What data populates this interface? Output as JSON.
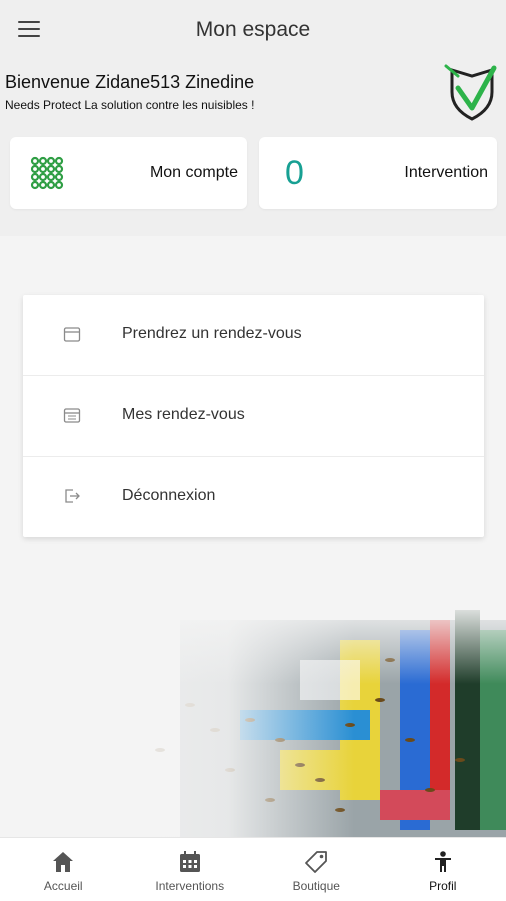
{
  "appbar": {
    "title": "Mon espace",
    "menu_icon": "hamburger-menu-icon"
  },
  "welcome": {
    "title": "Bienvenue Zidane513 Zinedine",
    "subtitle": "Needs Protect La solution contre les nuisibles !"
  },
  "logo": {
    "name": "shield-check-logo",
    "color": "#2db34a"
  },
  "cards": {
    "compte": {
      "label": "Mon compte",
      "icon": "grid-dots-icon",
      "icon_color": "#2f9e44"
    },
    "intervention": {
      "label": "Intervention",
      "count": "0",
      "count_color": "#17a093"
    }
  },
  "menu": {
    "items": [
      {
        "label": "Prendrez un rendez-vous",
        "icon": "calendar-icon"
      },
      {
        "label": "Mes rendez-vous",
        "icon": "calendar-list-icon"
      },
      {
        "label": "Déconnexion",
        "icon": "logout-icon"
      }
    ]
  },
  "bottom_nav": {
    "items": [
      {
        "label": "Accueil",
        "icon": "home-icon"
      },
      {
        "label": "Interventions",
        "icon": "calendar-grid-icon"
      },
      {
        "label": "Boutique",
        "icon": "tag-icon"
      },
      {
        "label": "Profil",
        "icon": "person-icon",
        "active": true
      }
    ]
  }
}
